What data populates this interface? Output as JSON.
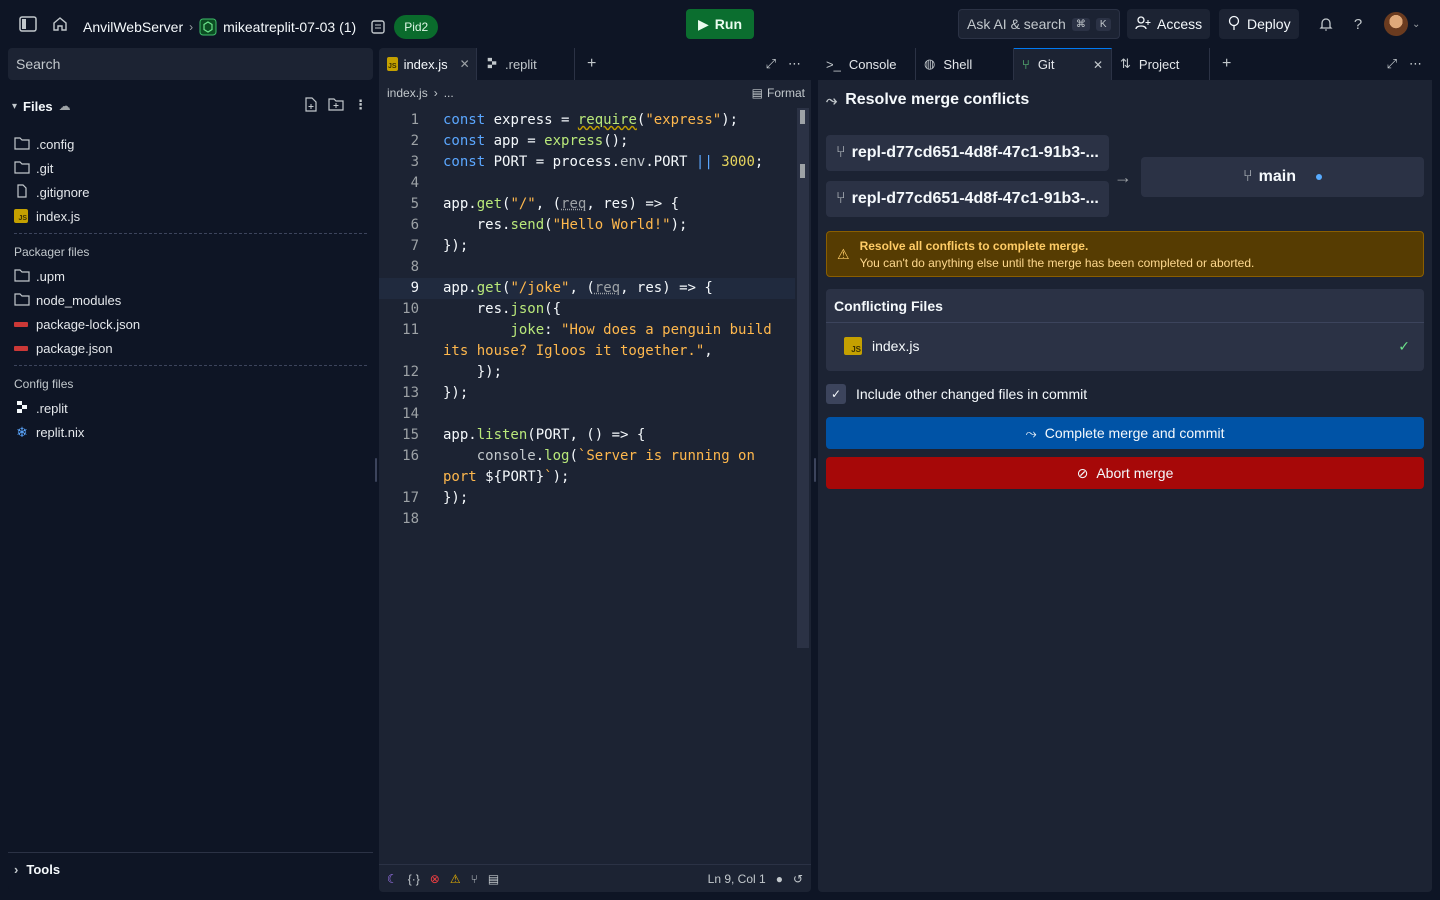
{
  "topbar": {
    "project_name": "AnvilWebServer",
    "repl_name": "mikeatreplit-07-03 (1)",
    "pid_badge": "Pid2",
    "run_label": "Run",
    "ask_ai_label": "Ask AI & search",
    "ask_ai_shortcut_1": "⌘",
    "ask_ai_shortcut_2": "K",
    "access_label": "Access",
    "deploy_label": "Deploy"
  },
  "sidebar": {
    "search_placeholder": "Search",
    "files_title": "Files",
    "files": [
      ".config",
      ".git",
      ".gitignore",
      "index.js"
    ],
    "packager_title": "Packager files",
    "packager_files": [
      ".upm",
      "node_modules",
      "package-lock.json",
      "package.json"
    ],
    "config_title": "Config files",
    "config_files": [
      ".replit",
      "replit.nix"
    ],
    "tools_label": "Tools"
  },
  "editor": {
    "tabs": [
      {
        "label": "index.js",
        "active": true
      },
      {
        "label": ".replit",
        "active": false
      }
    ],
    "breadcrumb_file": "index.js",
    "breadcrumb_more": "...",
    "format_label": "Format",
    "line_numbers": [
      "1",
      "2",
      "3",
      "4",
      "5",
      "6",
      "7",
      "8",
      "9",
      "10",
      "11",
      "",
      "12",
      "13",
      "14",
      "15",
      "16",
      "",
      "17",
      "18"
    ],
    "status_position": "Ln 9, Col 1"
  },
  "right": {
    "tabs": [
      {
        "label": "Console"
      },
      {
        "label": "Shell"
      },
      {
        "label": "Git",
        "active": true
      },
      {
        "label": "Project"
      }
    ],
    "title": "Resolve merge conflicts",
    "branch_1": "repl-d77cd651-4d8f-47c1-91b3-...",
    "branch_2": "repl-d77cd651-4d8f-47c1-91b3-...",
    "target_branch": "main",
    "warning_title": "Resolve all conflicts to complete merge.",
    "warning_body": "You can't do anything else until the merge has been completed or aborted.",
    "conflicting_title": "Conflicting Files",
    "conflicting_file": "index.js",
    "include_label": "Include other changed files in commit",
    "commit_label": "Complete merge and commit",
    "abort_label": "Abort merge"
  },
  "colors": {
    "background": "#0e1525",
    "panel": "#1c2333",
    "run_green": "#0b6e2f",
    "commit_blue": "#0053a6",
    "abort_red": "#a60808",
    "warning_bg": "#563c02"
  }
}
